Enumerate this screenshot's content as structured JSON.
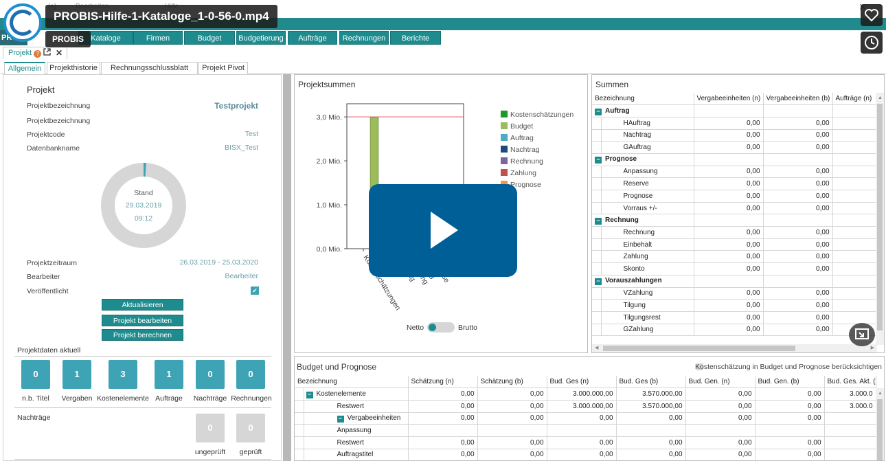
{
  "window": {
    "menu_1": "(a)",
    "menu_2": "Bearbeiten",
    "menu_3": "Hilfe",
    "app_short": "PRO"
  },
  "nav": {
    "items": [
      "Kataloge",
      "Firmen",
      "Budget",
      "Budgetierung",
      "Aufträge",
      "Rechnungen",
      "Berichte"
    ]
  },
  "doc_tab": {
    "label": "Projekt",
    "help": "?",
    "close": "✕"
  },
  "sub_tabs": [
    "Allgemein",
    "Projekthistorie",
    "Rechnungsschlussblatt (RSB)",
    "Projekt Pivot"
  ],
  "project": {
    "heading": "Projekt",
    "fields": [
      {
        "label": "Projektbezeichnung",
        "value": "Testprojekt"
      },
      {
        "label": "Projektbezeichnung",
        "value": ""
      },
      {
        "label": "Projektcode",
        "value": "Test"
      },
      {
        "label": "Datenbankname",
        "value": "BISX_Test"
      }
    ],
    "donut": {
      "label": "Stand",
      "date": "29.03.2019",
      "time": "09:12",
      "progress": 0.01
    },
    "fields2": [
      {
        "label": "Projektzeitraum",
        "value": "26.03.2019 - 25.03.2020"
      },
      {
        "label": "Bearbeiter",
        "value": "Bearbeiter"
      },
      {
        "label": "Veröffentlicht",
        "value": "✔"
      }
    ],
    "buttons": {
      "update": "Aktualisieren",
      "edit": "Projekt bearbeiten",
      "calc": "Projekt berechnen"
    }
  },
  "projektdaten": {
    "title": "Projektdaten aktuell",
    "kpis": [
      {
        "value": "0",
        "label": "n.b. Titel"
      },
      {
        "value": "1",
        "label": "Vergaben"
      },
      {
        "value": "3",
        "label": "Kostenelemente"
      },
      {
        "value": "1",
        "label": "Aufträge"
      },
      {
        "value": "0",
        "label": "Nachträge"
      },
      {
        "value": "0",
        "label": "Rechnungen"
      }
    ]
  },
  "nachtraege": {
    "title": "Nachträge",
    "kpis": [
      {
        "value": "0",
        "label": "ungeprüft"
      },
      {
        "value": "0",
        "label": "geprüft"
      }
    ]
  },
  "projektsummen": {
    "title": "Projektsummen",
    "toggle_left": "Netto",
    "toggle_right": "Brutto"
  },
  "chart_data": {
    "type": "bar",
    "title": "Projektsummen",
    "categories": [
      "Kostenschätzungen",
      "Budget",
      "Auftrag",
      "Nachtrag",
      "Rechnung",
      "Zahlung",
      "Prognose"
    ],
    "tick_labels_visible": [
      "Kostenschätzungen",
      "Nachtrag"
    ],
    "series": [
      {
        "name": "Kostenschätzungen",
        "color": "#1a9a2c",
        "values": [
          0,
          0,
          0,
          0,
          0,
          0,
          0
        ]
      },
      {
        "name": "Budget",
        "color": "#9cbb59",
        "values": [
          0,
          3.0,
          0,
          0,
          0,
          0,
          0
        ]
      },
      {
        "name": "Auftrag",
        "color": "#4aacc6",
        "values": [
          0,
          0,
          0,
          0,
          0,
          0,
          0
        ]
      },
      {
        "name": "Nachtrag",
        "color": "#1f497d",
        "values": [
          0,
          0,
          0,
          0,
          0,
          0,
          0
        ]
      },
      {
        "name": "Rechnung",
        "color": "#8064a2",
        "values": [
          0,
          0,
          0,
          0,
          0,
          0,
          0
        ]
      },
      {
        "name": "Zahlung",
        "color": "#c0504d",
        "values": [
          0,
          0,
          0,
          0,
          0,
          0,
          0
        ]
      },
      {
        "name": "Prognose",
        "color": "#f79646",
        "values": [
          0,
          0,
          0,
          0,
          0,
          0,
          0
        ]
      }
    ],
    "reference_line": {
      "value": 3.0,
      "color": "#e0555f"
    },
    "yticks": [
      "0,0 Mio.",
      "1,0 Mio.",
      "2,0 Mio.",
      "3,0 Mio."
    ],
    "ytick_values": [
      0,
      1,
      2,
      3
    ],
    "ylim": [
      0,
      3.3
    ],
    "legend_position": "right",
    "grid": false
  },
  "summen": {
    "title": "Summen",
    "columns": [
      "Bezeichnung",
      "Vergabeeinheiten (n)",
      "Vergabeeinheiten (b)",
      "Aufträge (n)"
    ],
    "groups": [
      {
        "name": "Auftrag",
        "rows": [
          {
            "label": "HAuftrag",
            "n": "0,00",
            "b": "0,00"
          },
          {
            "label": "Nachtrag",
            "n": "0,00",
            "b": "0,00"
          },
          {
            "label": "GAuftrag",
            "n": "0,00",
            "b": "0,00"
          }
        ]
      },
      {
        "name": "Prognose",
        "rows": [
          {
            "label": "Anpassung",
            "n": "0,00",
            "b": "0,00"
          },
          {
            "label": "Reserve",
            "n": "0,00",
            "b": "0,00"
          },
          {
            "label": "Prognose",
            "n": "0,00",
            "b": "0,00"
          },
          {
            "label": "Vorraus +/-",
            "n": "0,00",
            "b": "0,00"
          }
        ]
      },
      {
        "name": "Rechnung",
        "rows": [
          {
            "label": "Rechnung",
            "n": "0,00",
            "b": "0,00"
          },
          {
            "label": "Einbehalt",
            "n": "0,00",
            "b": "0,00"
          },
          {
            "label": "Zahlung",
            "n": "0,00",
            "b": "0,00"
          },
          {
            "label": "Skonto",
            "n": "0,00",
            "b": "0,00"
          }
        ]
      },
      {
        "name": "Vorauszahlungen",
        "rows": [
          {
            "label": "VZahlung",
            "n": "0,00",
            "b": "0,00"
          },
          {
            "label": "Tilgung",
            "n": "0,00",
            "b": "0,00"
          },
          {
            "label": "Tilgungsrest",
            "n": "0,00",
            "b": "0,00"
          },
          {
            "label": "GZahlung",
            "n": "0,00",
            "b": "0,00"
          }
        ]
      }
    ]
  },
  "budget": {
    "title": "Budget und Prognose",
    "checkbox_label": "Kostenschätzung in Budget und Prognose berücksichtigen",
    "columns": [
      "Bezeichnung",
      "Schätzung (n)",
      "Schätzung (b)",
      "Bud. Ges (n)",
      "Bud. Ges (b)",
      "Bud. Gen. (n)",
      "Bud. Gen. (b)",
      "Bud. Ges. Akt. (r"
    ],
    "rows": [
      {
        "label": "Kostenelemente",
        "level": 0,
        "group": true,
        "cells": [
          "0,00",
          "0,00",
          "3.000.000,00",
          "3.570.000,00",
          "0,00",
          "0,00",
          "3.000.0"
        ]
      },
      {
        "label": "Restwert",
        "level": 1,
        "group": false,
        "cells": [
          "0,00",
          "0,00",
          "3.000.000,00",
          "3.570.000,00",
          "0,00",
          "0,00",
          "3.000.0"
        ]
      },
      {
        "label": "Vergabeeinheiten",
        "level": 1,
        "group": true,
        "cells": [
          "0,00",
          "0,00",
          "0,00",
          "0,00",
          "0,00",
          "0,00",
          ""
        ]
      },
      {
        "label": "Anpassung",
        "level": 2,
        "group": false,
        "cells": [
          "",
          "",
          "",
          "",
          "",
          "",
          ""
        ]
      },
      {
        "label": "Restwert",
        "level": 2,
        "group": false,
        "cells": [
          "0,00",
          "0,00",
          "0,00",
          "0,00",
          "0,00",
          "0,00",
          ""
        ]
      },
      {
        "label": "Auftragstitel",
        "level": 2,
        "group": false,
        "cells": [
          "0,00",
          "0,00",
          "0,00",
          "0,00",
          "0,00",
          "0,00",
          ""
        ]
      }
    ]
  },
  "video_overlay": {
    "title": "PROBIS-Hilfe-1-Kataloge_1-0-56-0.mp4",
    "channel": "PROBIS"
  },
  "colors": {
    "accent": "#1e8c8e",
    "kpi": "#3ea3b4",
    "play": "#005f97"
  }
}
